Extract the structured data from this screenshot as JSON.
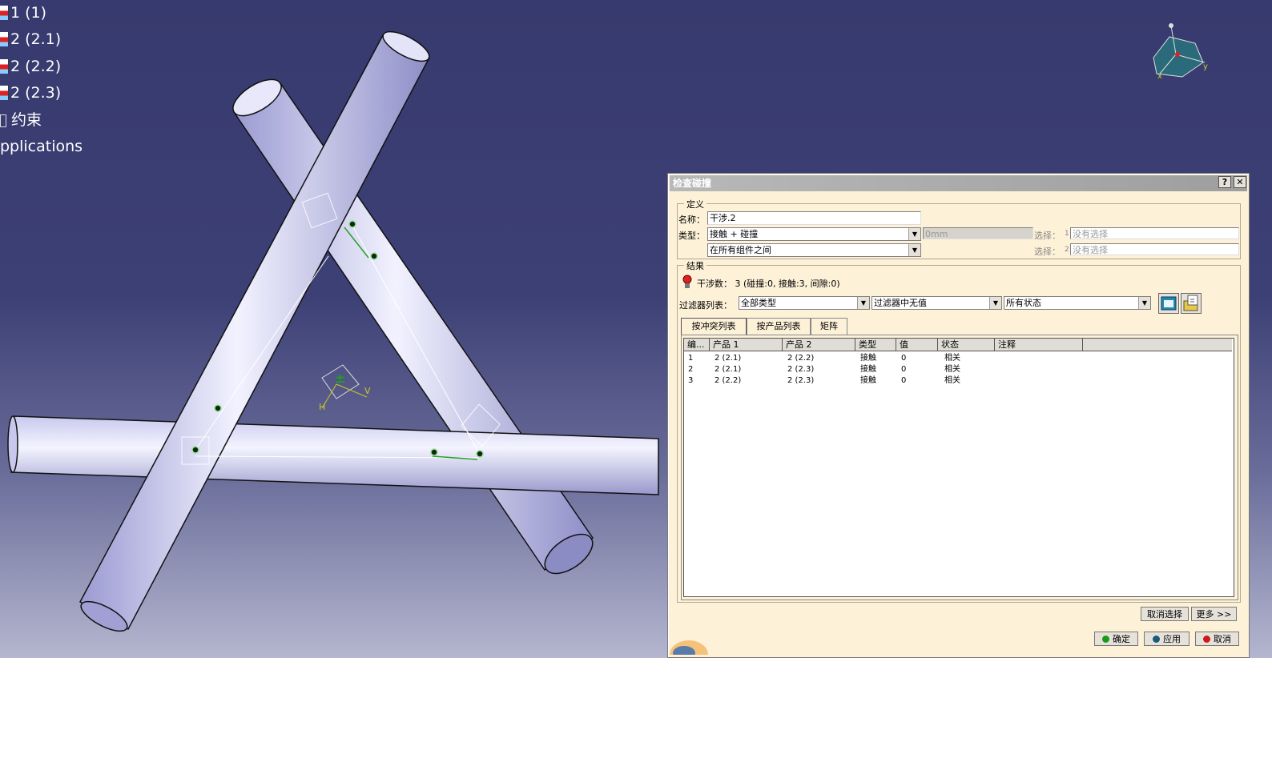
{
  "tree": {
    "items": [
      {
        "label": "1 (1)",
        "icon": "product-icon"
      },
      {
        "label": "2 (2.1)",
        "icon": "product-icon"
      },
      {
        "label": "2 (2.2)",
        "icon": "product-icon"
      },
      {
        "label": "2 (2.3)",
        "icon": "product-icon"
      },
      {
        "label": "约束",
        "icon": "constraints-icon"
      },
      {
        "label": "pplications",
        "icon": ""
      }
    ]
  },
  "compass": {
    "x_label": "x",
    "y_label": "y"
  },
  "axis_marker": {
    "h_label": "H",
    "v_label": "V"
  },
  "dialog": {
    "title": "检查碰撞",
    "help_btn": "?",
    "close_btn": "✕",
    "definition": {
      "legend": "定义",
      "name_label": "名称：",
      "name_value": "干涉.2",
      "type_label": "类型：",
      "type_value": "接触 + 碰撞",
      "scope_value": "在所有组件之间",
      "clearance_value": "0mm",
      "sel1_label": "选择：",
      "sel1_num": "1",
      "sel1_value": "没有选择",
      "sel2_label": "选择：",
      "sel2_num": "2",
      "sel2_value": "没有选择"
    },
    "result": {
      "legend": "结果",
      "summary": "干涉数： 3 (碰撞:0, 接触:3, 间隙:0)",
      "filter_label": "过滤器列表：",
      "filter1": "全部类型",
      "filter2": "过滤器中无值",
      "filter3": "所有状态",
      "tabs": [
        "按冲突列表",
        "按产品列表",
        "矩阵"
      ],
      "columns": [
        "编...",
        "产品 1",
        "产品 2",
        "类型",
        "值",
        "状态",
        "注释"
      ],
      "rows": [
        [
          "1",
          "2 (2.1)",
          "2 (2.2)",
          "接触",
          "0",
          "相关",
          ""
        ],
        [
          "2",
          "2 (2.1)",
          "2 (2.3)",
          "接触",
          "0",
          "相关",
          ""
        ],
        [
          "3",
          "2 (2.2)",
          "2 (2.3)",
          "接触",
          "0",
          "相关",
          ""
        ]
      ]
    },
    "buttons": {
      "deselect": "取消选择",
      "more": "更多 >>",
      "ok": "确定",
      "apply": "应用",
      "cancel": "取消"
    },
    "colors": {
      "ok": "#1a9a1a",
      "apply": "#1a5a7a",
      "cancel": "#cc1a1a"
    }
  }
}
